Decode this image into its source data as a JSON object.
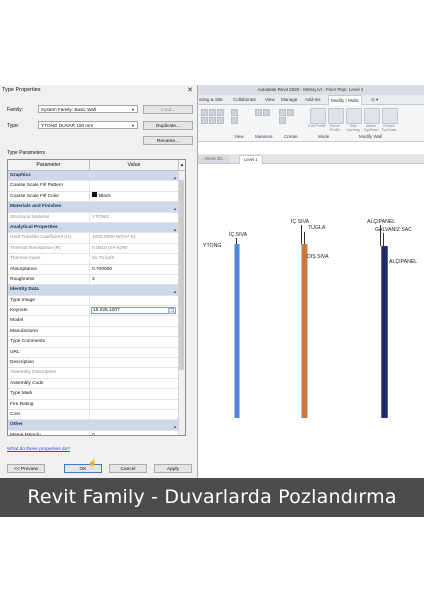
{
  "revit": {
    "window_title": "Autodesk Revit 2020 - Metraj.rvt - Floor Plan: Level 1",
    "ribbon_tabs": [
      "ssing & Site",
      "Collaborate",
      "View",
      "Manage",
      "Add-Ins",
      "Modify | Walls",
      "⊙ ▾"
    ],
    "active_tab": "Modify | Walls",
    "ribbon_tools": [
      "Edit Profile",
      "Reset Profile",
      "Wall Opening",
      "Attach Top/Base",
      "Detach Top/Base"
    ],
    "ribbon_groups": [
      "View",
      "Measure",
      "Create",
      "Mode",
      "Modify Wall"
    ],
    "view_tabs": [
      "...Views 3D...",
      "Level 1"
    ],
    "active_view": "Level 1",
    "wall_labels": {
      "ytong": "YTONG",
      "ic_siva_1": "İÇ SIVA",
      "ic_siva_2": "İÇ SIVA",
      "tugla": "TUGLA",
      "dis_siva": "DIŞ SIVA",
      "alcipanel_1": "ALÇIPANEL",
      "galvaniz": "GALVANİZ SAC",
      "alcipanel_2": "ALÇIPANEL"
    }
  },
  "dialog": {
    "title": "Type Properties",
    "close_label": "✕",
    "family_label": "Family:",
    "family_value": "System Family: Basic Wall",
    "type_label": "Type:",
    "type_value": "YTONG DUVAR 150 mm",
    "load_button": "Load...",
    "duplicate_button": "Duplicate...",
    "rename_button": "Rename...",
    "type_parameters_label": "Type Parameters",
    "col_parameter": "Parameter",
    "col_value": "Value",
    "col_scroll": "▴",
    "rows": [
      {
        "name": "Graphics",
        "value": "",
        "kind": "group"
      },
      {
        "name": "Coarse Scale Fill Pattern",
        "value": "",
        "kind": "normal"
      },
      {
        "name": "Coarse Scale Fill Color",
        "value": "Black",
        "kind": "color"
      },
      {
        "name": "Materials and Finishes",
        "value": "",
        "kind": "group"
      },
      {
        "name": "Structural Material",
        "value": "YTONG",
        "kind": "grey"
      },
      {
        "name": "Analytical Properties",
        "value": "",
        "kind": "group"
      },
      {
        "name": "Heat Transfer Coefficient (U)",
        "value": "1000.0000 W/(m²·K)",
        "kind": "grey"
      },
      {
        "name": "Thermal Resistance (R)",
        "value": "0.0010 (m²·K)/W",
        "kind": "grey"
      },
      {
        "name": "Thermal mass",
        "value": "51.75 kJ/K",
        "kind": "grey"
      },
      {
        "name": "Absorptance",
        "value": "0.700000",
        "kind": "normal"
      },
      {
        "name": "Roughness",
        "value": "3",
        "kind": "normal"
      },
      {
        "name": "Identity Data",
        "value": "",
        "kind": "group"
      },
      {
        "name": "Type Image",
        "value": "",
        "kind": "normal"
      },
      {
        "name": "Keynote",
        "value": "15.225.1007",
        "kind": "edit"
      },
      {
        "name": "Model",
        "value": "",
        "kind": "normal"
      },
      {
        "name": "Manufacturer",
        "value": "",
        "kind": "normal"
      },
      {
        "name": "Type Comments",
        "value": "",
        "kind": "normal"
      },
      {
        "name": "URL",
        "value": "",
        "kind": "normal"
      },
      {
        "name": "Description",
        "value": "",
        "kind": "normal"
      },
      {
        "name": "Assembly Description",
        "value": "",
        "kind": "grey"
      },
      {
        "name": "Assembly Code",
        "value": "",
        "kind": "normal"
      },
      {
        "name": "Type Mark",
        "value": "",
        "kind": "normal"
      },
      {
        "name": "Fire Rating",
        "value": "",
        "kind": "normal"
      },
      {
        "name": "Cost",
        "value": "",
        "kind": "normal"
      },
      {
        "name": "Other",
        "value": "",
        "kind": "group"
      },
      {
        "name": "Metraj Metodu",
        "value": "0",
        "kind": "normal"
      }
    ],
    "help_link": "What do these properties do?",
    "preview_button": "<< Preview",
    "ok_button": "OK",
    "cancel_button": "Cancel",
    "apply_button": "Apply"
  },
  "banner": {
    "text": "Revit Family - Duvarlarda Pozlandırma"
  },
  "colors": {
    "ytong_wall": "#4f86d8",
    "tugla_wall": "#c9783f",
    "siva_wall": "#9fc3e8",
    "alcipanel_wall": "#22286e",
    "group_row": "#cdd9ea",
    "banner": "#4c4c4c"
  }
}
